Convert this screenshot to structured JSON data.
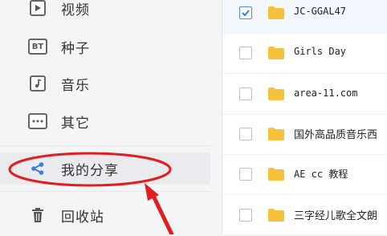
{
  "sidebar": {
    "items": [
      {
        "label": "视频",
        "icon": "video-icon"
      },
      {
        "label": "种子",
        "icon": "bt-icon",
        "icon_text": "BT"
      },
      {
        "label": "音乐",
        "icon": "music-icon"
      },
      {
        "label": "其它",
        "icon": "more-icon"
      },
      {
        "label": "我的分享",
        "icon": "share-icon"
      },
      {
        "label": "回收站",
        "icon": "trash-icon"
      }
    ]
  },
  "files": [
    {
      "name": "JC-GGAL47",
      "checked": true
    },
    {
      "name": "Girls Day",
      "checked": false
    },
    {
      "name": "area-11.com",
      "checked": false
    },
    {
      "name": "国外高品质音乐西",
      "checked": false
    },
    {
      "name": "AE cc 教程",
      "checked": false
    },
    {
      "name": "三字经儿歌全文朗",
      "checked": false
    }
  ],
  "colors": {
    "accent": "#3b7fe0",
    "folder": "#f7c23b",
    "annotation": "#e21d1d"
  }
}
